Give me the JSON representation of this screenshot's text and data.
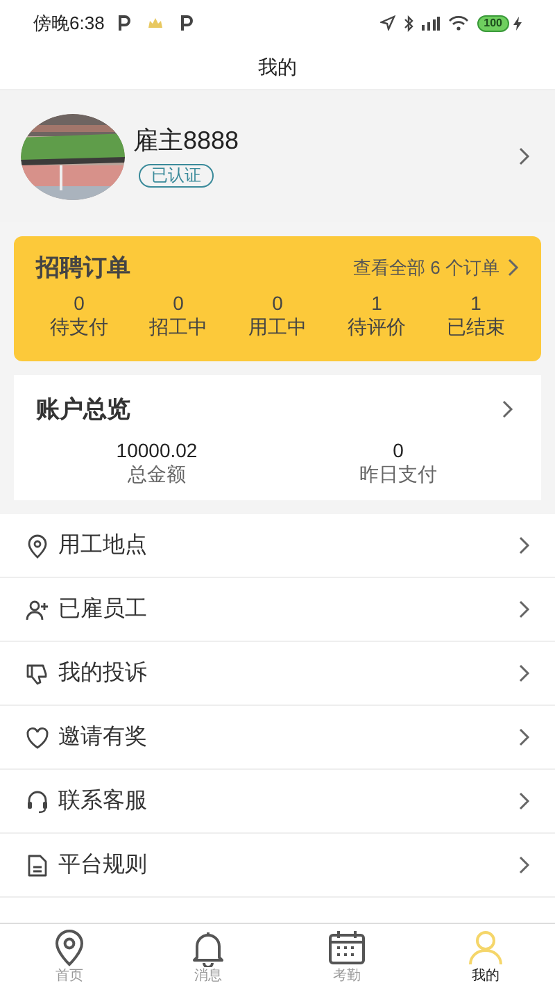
{
  "status_bar": {
    "time": "傍晚6:38",
    "battery": "100"
  },
  "header": {
    "title": "我的"
  },
  "profile": {
    "name": "雇主8888",
    "badge": "已认证"
  },
  "orders": {
    "title": "招聘订单",
    "link": "查看全部 6 个订单",
    "stats": [
      {
        "value": "0",
        "label": "待支付"
      },
      {
        "value": "0",
        "label": "招工中"
      },
      {
        "value": "0",
        "label": "用工中"
      },
      {
        "value": "1",
        "label": "待评价"
      },
      {
        "value": "1",
        "label": "已结束"
      }
    ]
  },
  "account": {
    "title": "账户总览",
    "stats": [
      {
        "value": "10000.02",
        "label": "总金额"
      },
      {
        "value": "0",
        "label": "昨日支付"
      }
    ]
  },
  "menu": [
    {
      "kind": "pin",
      "label": "用工地点"
    },
    {
      "kind": "personadd",
      "label": "已雇员工"
    },
    {
      "kind": "complaint",
      "label": "我的投诉"
    },
    {
      "kind": "invite",
      "label": "邀请有奖"
    },
    {
      "kind": "support",
      "label": "联系客服"
    },
    {
      "kind": "rules",
      "label": "平台规则"
    }
  ],
  "tabs": [
    {
      "kind": "home",
      "label": "首页",
      "selected": false
    },
    {
      "kind": "messages",
      "label": "消息",
      "selected": false
    },
    {
      "kind": "attendance",
      "label": "考勤",
      "selected": false
    },
    {
      "kind": "profile",
      "label": "我的",
      "selected": true
    }
  ]
}
